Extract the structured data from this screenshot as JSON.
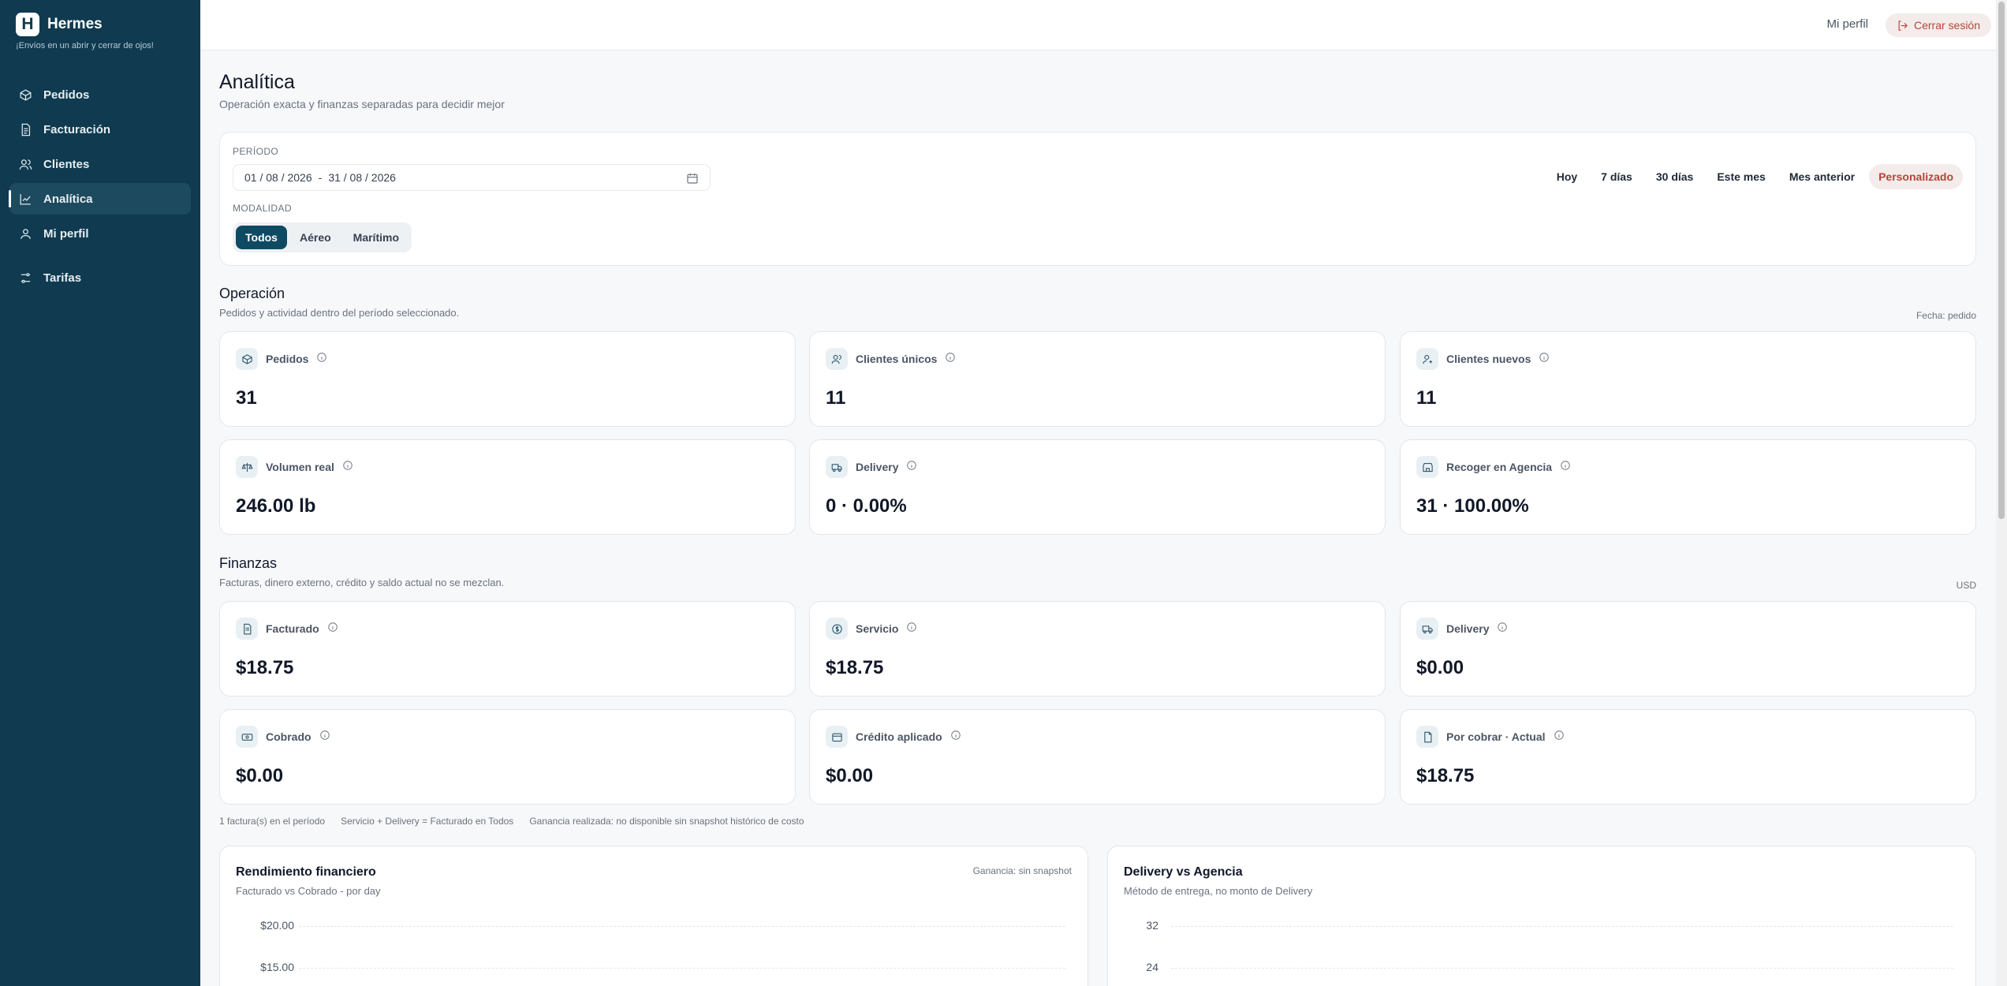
{
  "brand": {
    "logo_letter": "H",
    "name": "Hermes",
    "tagline": "¡Envíos en un abrir y cerrar de ojos!"
  },
  "sidebar": {
    "items": [
      {
        "label": "Pedidos",
        "icon": "package-icon"
      },
      {
        "label": "Facturación",
        "icon": "invoice-icon"
      },
      {
        "label": "Clientes",
        "icon": "users-icon"
      },
      {
        "label": "Analítica",
        "icon": "chart-icon",
        "active": true
      },
      {
        "label": "Mi perfil",
        "icon": "user-icon"
      },
      {
        "label": "Tarifas",
        "icon": "sliders-icon"
      }
    ]
  },
  "topbar": {
    "profile": "Mi perfil",
    "logout": "Cerrar sesión"
  },
  "page": {
    "title": "Analítica",
    "subtitle": "Operación exacta y finanzas separadas para decidir mejor"
  },
  "filters": {
    "period_label": "PERÍODO",
    "date_from": "01 / 08 / 2026",
    "date_sep": "-",
    "date_to": "31 / 08 / 2026",
    "mode_label": "MODALIDAD",
    "modes": [
      "Todos",
      "Aéreo",
      "Marítimo"
    ],
    "active_mode": "Todos",
    "presets": [
      "Hoy",
      "7 días",
      "30 días",
      "Este mes",
      "Mes anterior",
      "Personalizado"
    ],
    "active_preset": "Personalizado"
  },
  "operacion": {
    "title": "Operación",
    "subtitle": "Pedidos y actividad dentro del período seleccionado.",
    "note": "Fecha: pedido",
    "kpis": [
      {
        "label": "Pedidos",
        "value": "31",
        "icon": "package-icon"
      },
      {
        "label": "Clientes únicos",
        "value": "11",
        "icon": "users-icon"
      },
      {
        "label": "Clientes nuevos",
        "value": "11",
        "icon": "user-plus-icon"
      },
      {
        "label": "Volumen real",
        "value": "246.00 lb",
        "icon": "scale-icon"
      },
      {
        "label": "Delivery",
        "value": "0 · 0.00%",
        "icon": "truck-icon"
      },
      {
        "label": "Recoger en Agencia",
        "value": "31 · 100.00%",
        "icon": "store-icon"
      }
    ]
  },
  "finanzas": {
    "title": "Finanzas",
    "subtitle": "Facturas, dinero externo, crédito y saldo actual no se mezclan.",
    "note": "USD",
    "kpis": [
      {
        "label": "Facturado",
        "value": "$18.75",
        "icon": "invoice-icon"
      },
      {
        "label": "Servicio",
        "value": "$18.75",
        "icon": "dollar-icon"
      },
      {
        "label": "Delivery",
        "value": "$0.00",
        "icon": "truck-icon"
      },
      {
        "label": "Cobrado",
        "value": "$0.00",
        "icon": "cash-icon"
      },
      {
        "label": "Crédito aplicado",
        "value": "$0.00",
        "icon": "wallet-icon"
      },
      {
        "label": "Por cobrar · Actual",
        "value": "$18.75",
        "icon": "file-icon"
      }
    ],
    "footnotes": [
      "1 factura(s) en el período",
      "Servicio + Delivery = Facturado en Todos",
      "Ganancia realizada: no disponible sin snapshot histórico de costo"
    ]
  },
  "charts": [
    {
      "title": "Rendimiento financiero",
      "subtitle": "Facturado vs Cobrado - por day",
      "note": "Ganancia: sin snapshot",
      "ticks": [
        "$20.00",
        "$15.00"
      ]
    },
    {
      "title": "Delivery vs Agencia",
      "subtitle": "Método de entrega, no monto de Delivery",
      "note": "",
      "ticks": [
        "32",
        "24"
      ]
    }
  ]
}
